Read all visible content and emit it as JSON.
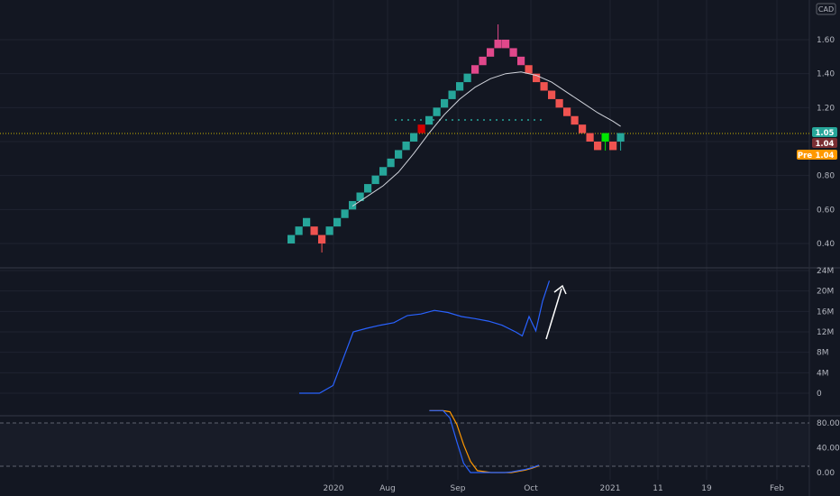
{
  "app": {
    "currency": "CAD"
  },
  "colors": {
    "background": "#131722",
    "grid": "#1f2330",
    "up": "#26a69a",
    "down": "#ef5350",
    "ma": "#d1d4dc",
    "volume": "#2962ff",
    "stoch_k": "#2962ff",
    "stoch_d": "#ff9800",
    "last_up": "#26a69a",
    "last_down": "#7a2e33",
    "pre": "#ff9800",
    "highlight_up": "#00e600",
    "highlight_down": "#d50000"
  },
  "price_labels": {
    "last": "1.05",
    "prev": "1.04",
    "pre_tag": "Pre",
    "pre": "1.04"
  },
  "chart_data": [
    {
      "type": "renko",
      "name": "price",
      "ylim": [
        0.32,
        1.74
      ],
      "yticks": [
        0.4,
        0.6,
        0.8,
        1.0,
        1.2,
        1.4,
        1.6
      ],
      "xticks": [
        "2020",
        "Aug",
        "Sep",
        "Oct",
        "2021",
        "11",
        "19",
        "Feb"
      ],
      "brick_size": 0.05,
      "bricks": [
        {
          "low": 0.4,
          "dir": "up"
        },
        {
          "low": 0.45,
          "dir": "up"
        },
        {
          "low": 0.5,
          "dir": "up"
        },
        {
          "low": 0.45,
          "dir": "down"
        },
        {
          "low": 0.4,
          "dir": "down"
        },
        {
          "low": 0.45,
          "dir": "up"
        },
        {
          "low": 0.5,
          "dir": "up"
        },
        {
          "low": 0.55,
          "dir": "up"
        },
        {
          "low": 0.6,
          "dir": "up"
        },
        {
          "low": 0.65,
          "dir": "up"
        },
        {
          "low": 0.7,
          "dir": "up"
        },
        {
          "low": 0.75,
          "dir": "up"
        },
        {
          "low": 0.8,
          "dir": "up"
        },
        {
          "low": 0.85,
          "dir": "up"
        },
        {
          "low": 0.9,
          "dir": "up"
        },
        {
          "low": 0.95,
          "dir": "up"
        },
        {
          "low": 1.0,
          "dir": "up"
        },
        {
          "low": 1.05,
          "dir": "up",
          "highlight": true
        },
        {
          "low": 1.1,
          "dir": "up"
        },
        {
          "low": 1.15,
          "dir": "up"
        },
        {
          "low": 1.2,
          "dir": "up"
        },
        {
          "low": 1.25,
          "dir": "up"
        },
        {
          "low": 1.3,
          "dir": "up"
        },
        {
          "low": 1.35,
          "dir": "up"
        },
        {
          "low": 1.4,
          "dir": "up"
        },
        {
          "low": 1.45,
          "dir": "up"
        },
        {
          "low": 1.5,
          "dir": "up"
        },
        {
          "low": 1.55,
          "dir": "up"
        },
        {
          "low": 1.55,
          "dir": "down"
        },
        {
          "low": 1.5,
          "dir": "down"
        },
        {
          "low": 1.45,
          "dir": "down"
        },
        {
          "low": 1.4,
          "dir": "down"
        },
        {
          "low": 1.35,
          "dir": "down"
        },
        {
          "low": 1.3,
          "dir": "down"
        },
        {
          "low": 1.25,
          "dir": "down"
        },
        {
          "low": 1.2,
          "dir": "down"
        },
        {
          "low": 1.15,
          "dir": "down"
        },
        {
          "low": 1.1,
          "dir": "down"
        },
        {
          "low": 1.05,
          "dir": "down"
        },
        {
          "low": 1.0,
          "dir": "down"
        },
        {
          "low": 0.95,
          "dir": "down"
        },
        {
          "low": 1.0,
          "dir": "up",
          "highlight": true
        },
        {
          "low": 0.95,
          "dir": "down"
        },
        {
          "low": 1.0,
          "dir": "up"
        }
      ],
      "ma": [
        [
          8,
          0.62
        ],
        [
          10,
          0.68
        ],
        [
          12,
          0.74
        ],
        [
          14,
          0.82
        ],
        [
          16,
          0.93
        ],
        [
          18,
          1.05
        ],
        [
          20,
          1.16
        ],
        [
          22,
          1.25
        ],
        [
          24,
          1.32
        ],
        [
          26,
          1.37
        ],
        [
          28,
          1.4
        ],
        [
          30,
          1.41
        ],
        [
          32,
          1.39
        ],
        [
          34,
          1.35
        ],
        [
          36,
          1.29
        ],
        [
          38,
          1.23
        ],
        [
          40,
          1.17
        ],
        [
          42,
          1.12
        ],
        [
          43,
          1.09
        ]
      ]
    },
    {
      "type": "line",
      "name": "volume",
      "ylim": [
        -2000000,
        25500000
      ],
      "yticks": [
        0,
        4000000,
        8000000,
        12000000,
        16000000,
        20000000,
        24000000
      ],
      "ytick_labels": [
        "0",
        "4M",
        "8M",
        "12M",
        "16M",
        "20M",
        "24M"
      ],
      "values": [
        [
          0,
          0
        ],
        [
          3,
          0
        ],
        [
          5,
          1500000
        ],
        [
          6,
          5000000
        ],
        [
          8,
          12000000
        ],
        [
          10,
          12700000
        ],
        [
          12,
          13300000
        ],
        [
          14,
          13800000
        ],
        [
          16,
          15200000
        ],
        [
          18,
          15500000
        ],
        [
          20,
          16200000
        ],
        [
          22,
          15800000
        ],
        [
          24,
          15000000
        ],
        [
          26,
          14600000
        ],
        [
          28,
          14100000
        ],
        [
          30,
          13300000
        ],
        [
          32,
          12000000
        ],
        [
          33,
          11200000
        ],
        [
          34,
          15000000
        ],
        [
          35,
          12200000
        ],
        [
          36,
          18000000
        ],
        [
          37,
          22000000
        ]
      ]
    },
    {
      "type": "line",
      "name": "stochastic",
      "ylim": [
        -8,
        112
      ],
      "yticks": [
        0,
        40,
        80
      ],
      "ytick_labels": [
        "0.00",
        "40.00",
        "80.00"
      ],
      "bands": [
        20,
        80
      ],
      "k": [
        [
          19,
          100
        ],
        [
          21,
          100
        ],
        [
          22,
          88
        ],
        [
          23,
          50
        ],
        [
          24,
          15
        ],
        [
          25,
          0
        ],
        [
          27,
          0
        ],
        [
          29,
          0
        ],
        [
          30,
          0
        ],
        [
          31,
          1
        ],
        [
          32,
          3
        ],
        [
          33,
          5
        ],
        [
          34,
          8
        ],
        [
          35,
          12
        ]
      ],
      "d": [
        [
          19,
          100
        ],
        [
          21,
          100
        ],
        [
          22,
          98
        ],
        [
          23,
          78
        ],
        [
          24,
          45
        ],
        [
          25,
          18
        ],
        [
          26,
          3
        ],
        [
          28,
          0
        ],
        [
          30,
          0
        ],
        [
          31,
          0
        ],
        [
          32,
          2
        ],
        [
          33,
          4
        ],
        [
          34,
          7
        ],
        [
          35,
          11
        ]
      ]
    }
  ]
}
